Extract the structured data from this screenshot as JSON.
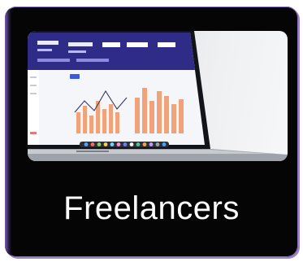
{
  "card": {
    "title": "Freelancers",
    "image_icon": "laptop-dashboard-image"
  }
}
